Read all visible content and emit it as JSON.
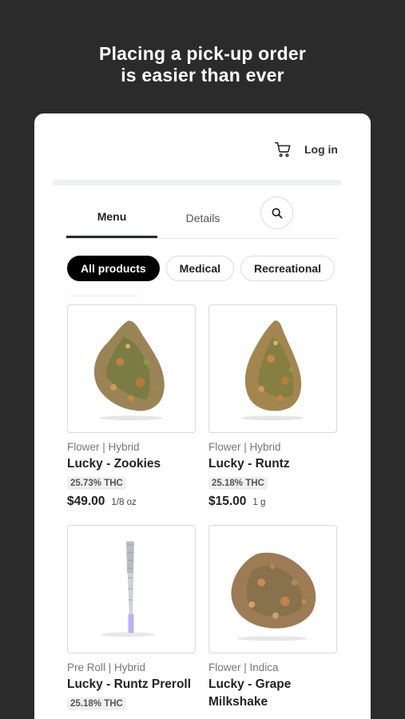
{
  "headline": {
    "line1": "Placing a pick-up order",
    "line2": "is easier than ever"
  },
  "header": {
    "cart_icon": "cart-icon",
    "login_label": "Log in"
  },
  "tabs": [
    {
      "label": "Menu",
      "active": true
    },
    {
      "label": "Details",
      "active": false
    }
  ],
  "search": {
    "icon": "search-icon"
  },
  "filters": [
    {
      "label": "All products",
      "active": true
    },
    {
      "label": "Medical",
      "active": false
    },
    {
      "label": "Recreational",
      "active": false
    }
  ],
  "products": [
    {
      "category": "Flower | Hybrid",
      "name": "Lucky - Zookies",
      "thc": "25.73% THC",
      "price": "$49.00",
      "qty": "1/8 oz",
      "image": "flower-bud"
    },
    {
      "category": "Flower | Hybrid",
      "name": "Lucky - Runtz",
      "thc": "25.18% THC",
      "price": "$15.00",
      "qty": "1 g",
      "image": "flower-bud"
    },
    {
      "category": "Pre Roll | Hybrid",
      "name": "Lucky - Runtz Preroll",
      "thc": "25.18% THC",
      "image": "pre-roll"
    },
    {
      "category": "Flower | Indica",
      "name": "Lucky - Grape Milkshake",
      "image": "flower-bud"
    }
  ],
  "colors": {
    "background": "#2b2b2b",
    "active_chip": "#000000",
    "tab_indicator": "#272b3a"
  }
}
